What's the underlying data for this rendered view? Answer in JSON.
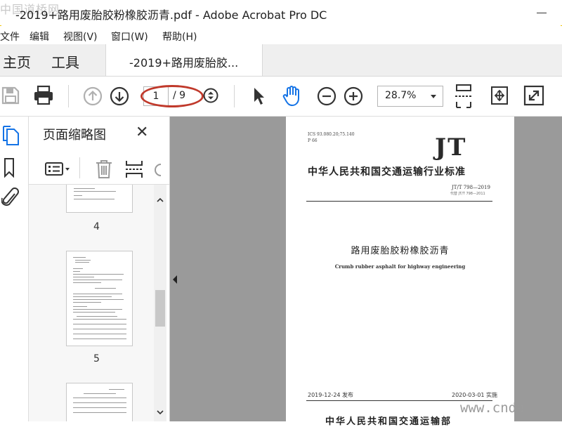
{
  "window": {
    "title": "-2019+路用废胎胶粉橡胶沥青.pdf - Adobe Acrobat Pro DC",
    "watermark_top": "中国道桥网"
  },
  "menu": [
    "文件",
    "编辑",
    "视图(V)",
    "窗口(W)",
    "帮助(H)"
  ],
  "tabs": {
    "home": "主页",
    "tools": "工具",
    "document": "-2019+路用废胎胶..."
  },
  "toolbar": {
    "page_current": "1",
    "page_total": "/ 9",
    "zoom": "28.7%"
  },
  "thumbnail_panel": {
    "title": "页面缩略图",
    "pages": [
      "4",
      "5"
    ]
  },
  "document": {
    "ics": "ICS 93.080.20;75.140",
    "ccs": "P 66",
    "logo": "JT",
    "standard_title": "中华人民共和国交通运输行业标准",
    "standard_no": "JT/T 798—2019",
    "replaces": "代替 JT/T 798—2011",
    "title_cn": "路用废胎胶粉橡胶沥青",
    "title_en": "Crumb rubber asphalt for highway engineering",
    "publish_date": "2019-12-24 发布",
    "effective_date": "2020-03-01 实施",
    "issuer": "中华人民共和国交通运输部"
  },
  "watermark_bottom": "www.cnda"
}
